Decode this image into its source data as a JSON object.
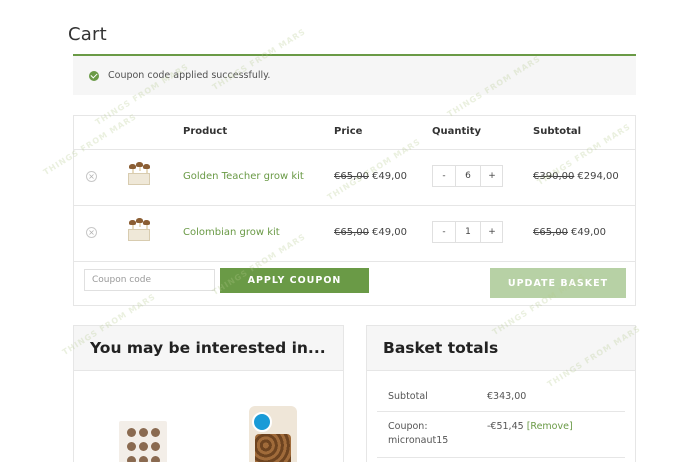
{
  "page": {
    "title": "Cart"
  },
  "notice": {
    "message": "Coupon code applied successfully."
  },
  "cart": {
    "headers": {
      "product": "Product",
      "price": "Price",
      "quantity": "Quantity",
      "subtotal": "Subtotal"
    },
    "items": [
      {
        "name": "Golden Teacher grow kit",
        "price_old": "€65,00",
        "price_new": "€49,00",
        "qty": "6",
        "subtotal_old": "€390,00",
        "subtotal_new": "€294,00"
      },
      {
        "name": "Colombian grow kit",
        "price_old": "€65,00",
        "price_new": "€49,00",
        "qty": "1",
        "subtotal_old": "€65,00",
        "subtotal_new": "€49,00"
      }
    ],
    "qty_minus": "-",
    "qty_plus": "+",
    "remove_symbol": "×",
    "coupon_placeholder": "Coupon code",
    "apply_label": "Apply coupon",
    "update_label": "Update basket"
  },
  "interest": {
    "title": "You may be interested in..."
  },
  "totals": {
    "title": "Basket totals",
    "subtotal_label": "Subtotal",
    "subtotal_value": "€343,00",
    "coupon_label": "Coupon:",
    "coupon_code": "micronaut15",
    "coupon_value": "-€51,45",
    "remove_link": "[Remove]"
  },
  "watermark": {
    "text": "THINGS FROM MARS"
  },
  "colors": {
    "brand_green": "#6a9a46",
    "update_disabled": "#b7d1a5",
    "panel_bg": "#f6f6f6"
  },
  "icons": {
    "notice": "check-circle-icon",
    "remove": "close-circle-icon"
  }
}
